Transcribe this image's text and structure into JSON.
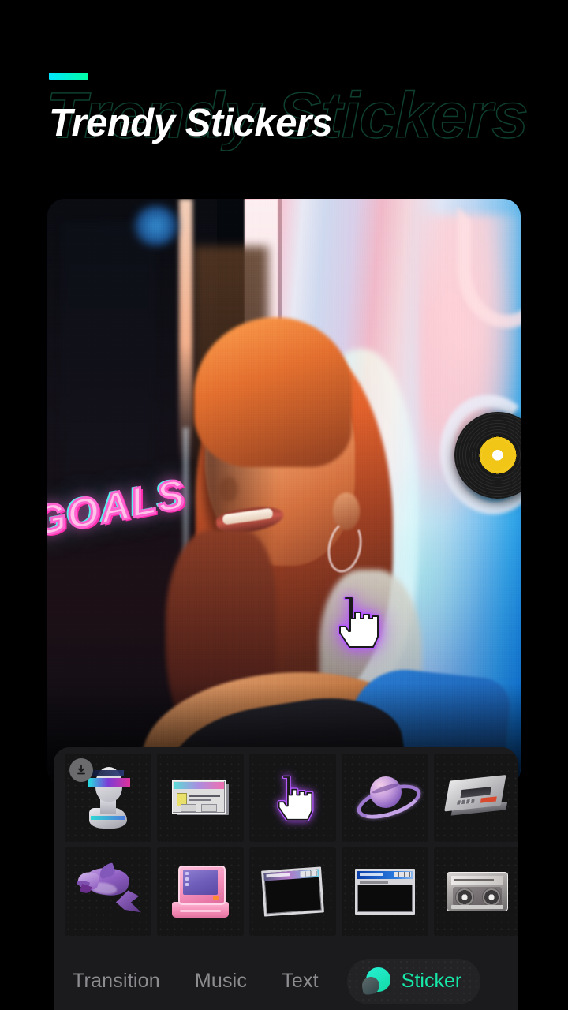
{
  "header": {
    "title": "Trendy Stickers",
    "ghost_title": "Trendy Stickers",
    "accent_color": "#00ffa3",
    "accent_gradient_start": "#00e5ff"
  },
  "canvas": {
    "name": "video-preview",
    "stickers_applied": [
      {
        "name": "goals-text-sticker",
        "text": "GOALS",
        "colors": [
          "#ff2fb0",
          "#54f2ef",
          "#ffc3ea"
        ]
      },
      {
        "name": "vinyl-record-sticker",
        "label_color": "#f2c617"
      },
      {
        "name": "hand-cursor-sticker",
        "glow_color": "#b45aff"
      }
    ]
  },
  "sticker_panel": {
    "rows": [
      [
        {
          "name": "sticker-glitch-bust",
          "downloadable": true,
          "badge": "download-icon"
        },
        {
          "name": "sticker-retro-dialog",
          "downloadable": false
        },
        {
          "name": "sticker-hand-cursor",
          "downloadable": false
        },
        {
          "name": "sticker-planet-saturn",
          "downloadable": false
        },
        {
          "name": "sticker-vhs-deck",
          "downloadable": false
        },
        {
          "name": "sticker-partial-edge-1",
          "downloadable": false
        }
      ],
      [
        {
          "name": "sticker-dolphin",
          "downloadable": false
        },
        {
          "name": "sticker-retro-computer",
          "downloadable": false
        },
        {
          "name": "sticker-window-frame-pink",
          "downloadable": false
        },
        {
          "name": "sticker-window-frame-blue",
          "downloadable": false
        },
        {
          "name": "sticker-cassette-tape",
          "downloadable": false
        },
        {
          "name": "sticker-partial-edge-2",
          "downloadable": false
        }
      ]
    ]
  },
  "toolbar": {
    "transition_label": "Transition",
    "music_label": "Music",
    "text_label": "Text",
    "sticker_label": "Sticker",
    "active_tab": "Sticker",
    "active_color": "#16e8a8",
    "inactive_color": "#8d8d91"
  }
}
